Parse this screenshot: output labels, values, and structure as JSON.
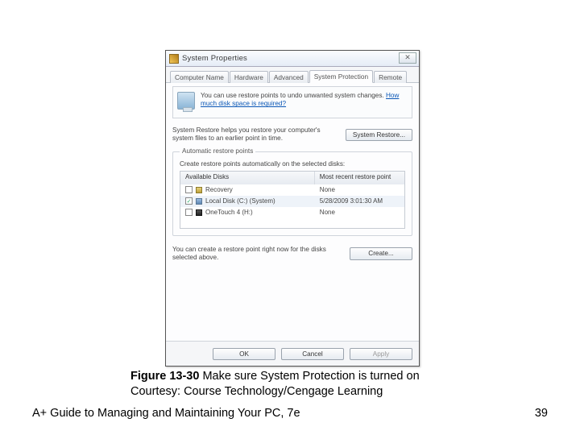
{
  "dialog": {
    "title": "System Properties",
    "close_label": "✕",
    "tabs": [
      "Computer Name",
      "Hardware",
      "Advanced",
      "System Protection",
      "Remote"
    ],
    "active_tab_index": 3,
    "info_text": "You can use restore points to undo unwanted system changes. ",
    "info_link": "How much disk space is required?",
    "restore_text": "System Restore helps you restore your computer's system files to an earlier point in time.",
    "restore_btn": "System Restore...",
    "group_label": "Automatic restore points",
    "group_desc": "Create restore points automatically on the selected disks:",
    "cols": {
      "a": "Available Disks",
      "b": "Most recent restore point"
    },
    "disks": [
      {
        "checked": false,
        "icon": "yellow",
        "name": "Recovery",
        "recent": "None"
      },
      {
        "checked": true,
        "icon": "blue",
        "name": "Local Disk (C:) (System)",
        "recent": "5/28/2009 3:01:30 AM"
      },
      {
        "checked": false,
        "icon": "black",
        "name": "OneTouch 4 (H:)",
        "recent": "None"
      }
    ],
    "create_text": "You can create a restore point right now for the disks selected above.",
    "create_btn": "Create...",
    "buttons": {
      "ok": "OK",
      "cancel": "Cancel",
      "apply": "Apply"
    }
  },
  "caption": {
    "label": "Figure 13-30",
    "text": " Make sure System Protection is turned on",
    "courtesy": "Courtesy: Course Technology/Cengage Learning"
  },
  "footer": {
    "book": "A+ Guide to Managing and Maintaining Your PC, 7e",
    "page": "39"
  }
}
